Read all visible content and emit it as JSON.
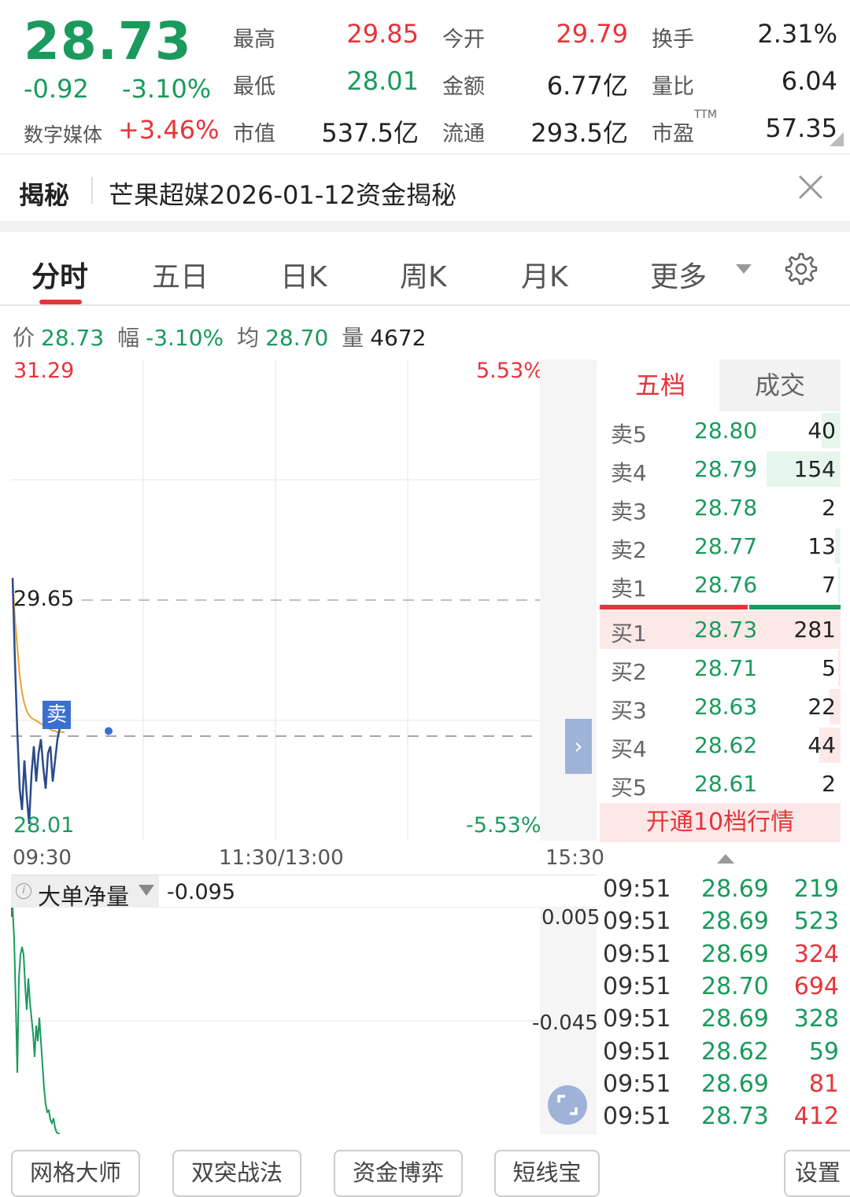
{
  "quote": {
    "price": "28.73",
    "change": "-0.92",
    "change_pct": "-3.10%",
    "sector_name": "数字媒体",
    "sector_pct": "+3.46%",
    "fields": [
      {
        "label": "最高",
        "value": "29.85",
        "color": "#e8333a"
      },
      {
        "label": "今开",
        "value": "29.79",
        "color": "#e8333a"
      },
      {
        "label": "换手",
        "value": "2.31%",
        "color": "#222222"
      },
      {
        "label": "最低",
        "value": "28.01",
        "color": "#1a9a5c"
      },
      {
        "label": "金额",
        "value": "6.77亿",
        "color": "#222222"
      },
      {
        "label": "量比",
        "value": "6.04",
        "color": "#222222"
      },
      {
        "label": "市值",
        "value": "537.5亿",
        "color": "#222222"
      },
      {
        "label": "流通",
        "value": "293.5亿",
        "color": "#222222"
      },
      {
        "label": "市盈",
        "value": "57.35",
        "color": "#222222"
      }
    ],
    "ttm": "TTM"
  },
  "reveal": {
    "tag": "揭秘",
    "text": "芒果超媒2026-01-12资金揭秘"
  },
  "tabs": [
    "分时",
    "五日",
    "日K",
    "周K",
    "月K",
    "更多"
  ],
  "info": {
    "price_label": "价",
    "price": "28.73",
    "range_label": "幅",
    "range": "-3.10%",
    "avg_label": "均",
    "avg": "28.70",
    "vol_label": "量",
    "vol": "4672"
  },
  "chart": {
    "high": "31.29",
    "high_pct": "5.53%",
    "ref": "29.65",
    "low": "28.01",
    "low_pct": "-5.53%",
    "sell_marker": "卖",
    "times": [
      "09:30",
      "11:30/13:00",
      "15:30"
    ],
    "colors": {
      "price_line": "#2b4a8b",
      "avg_line": "#f0a030"
    }
  },
  "chart_data": {
    "type": "line",
    "ylim": [
      28.01,
      31.29
    ],
    "series": [
      {
        "values": [
          29.79,
          29.2,
          28.7,
          28.3,
          28.15,
          28.5,
          28.25,
          28.05,
          28.4,
          28.6,
          28.35,
          28.55,
          28.65,
          28.45,
          28.3,
          28.55,
          28.6,
          28.35,
          28.5,
          28.65,
          28.73,
          28.8,
          28.73
        ]
      },
      {
        "values": [
          29.79,
          29.5,
          29.3,
          29.1,
          28.98,
          28.9,
          28.85,
          28.82,
          28.8,
          28.79,
          28.78,
          28.77,
          28.76,
          28.75,
          28.74,
          28.73,
          28.72,
          28.71,
          28.71,
          28.7,
          28.7,
          28.7,
          28.7
        ]
      }
    ]
  },
  "book": {
    "tab_five": "五档",
    "tab_deal": "成交",
    "sells": [
      {
        "label": "卖5",
        "price": "28.80",
        "vol": "40",
        "frac": 0.14
      },
      {
        "label": "卖4",
        "price": "28.79",
        "vol": "154",
        "frac": 0.55
      },
      {
        "label": "卖3",
        "price": "28.78",
        "vol": "2",
        "frac": 0.0
      },
      {
        "label": "卖2",
        "price": "28.77",
        "vol": "13",
        "frac": 0.04
      },
      {
        "label": "卖1",
        "price": "28.76",
        "vol": "7",
        "frac": 0.02
      }
    ],
    "buys": [
      {
        "label": "买1",
        "price": "28.73",
        "vol": "281",
        "frac": 1.0
      },
      {
        "label": "买2",
        "price": "28.71",
        "vol": "5",
        "frac": 0.02
      },
      {
        "label": "买3",
        "price": "28.63",
        "vol": "22",
        "frac": 0.08
      },
      {
        "label": "买4",
        "price": "28.62",
        "vol": "44",
        "frac": 0.16
      },
      {
        "label": "买5",
        "price": "28.61",
        "vol": "2",
        "frac": 0.0
      }
    ],
    "open10": "开通10档行情"
  },
  "indicator": {
    "name": "大单净量",
    "value": "-0.095",
    "max": "0.005",
    "mid": "-0.045"
  },
  "trades": [
    {
      "time": "09:51",
      "price": "28.69",
      "vol": "219",
      "color": "#1a9a5c"
    },
    {
      "time": "09:51",
      "price": "28.69",
      "vol": "523",
      "color": "#1a9a5c"
    },
    {
      "time": "09:51",
      "price": "28.69",
      "vol": "324",
      "color": "#e8333a"
    },
    {
      "time": "09:51",
      "price": "28.70",
      "vol": "694",
      "color": "#e8333a"
    },
    {
      "time": "09:51",
      "price": "28.69",
      "vol": "328",
      "color": "#1a9a5c"
    },
    {
      "time": "09:51",
      "price": "28.62",
      "vol": "59",
      "color": "#1a9a5c"
    },
    {
      "time": "09:51",
      "price": "28.69",
      "vol": "81",
      "color": "#e8333a"
    },
    {
      "time": "09:51",
      "price": "28.73",
      "vol": "412",
      "color": "#e8333a"
    }
  ],
  "bottom_buttons": [
    "网格大师",
    "双突战法",
    "资金博弈",
    "短线宝",
    "设置"
  ]
}
